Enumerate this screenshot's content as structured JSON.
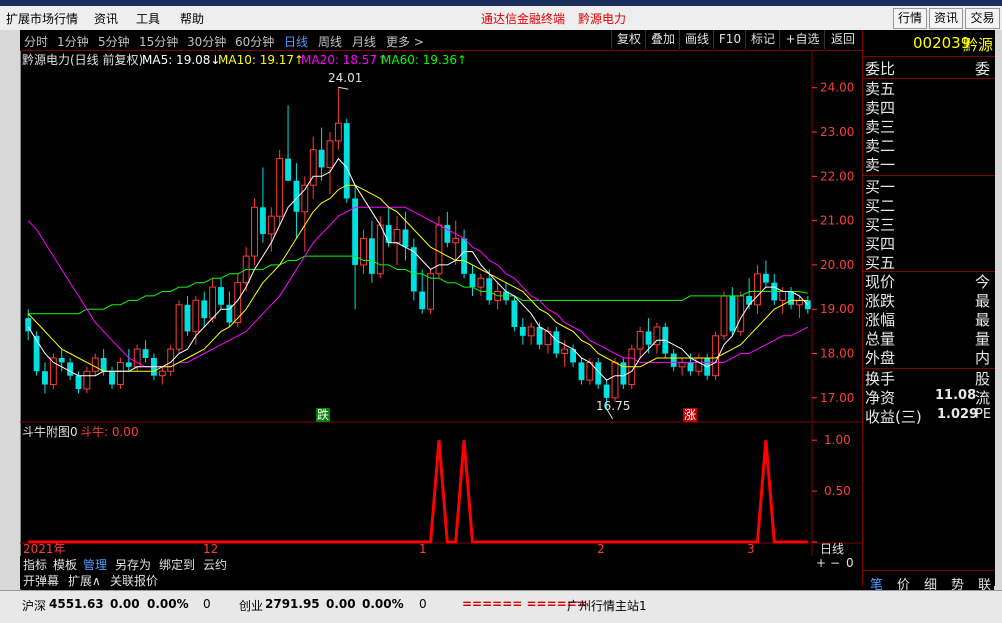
{
  "menubar": {
    "items": [
      "扩展市场行情",
      "资讯",
      "工具",
      "帮助"
    ],
    "center_red": [
      "通达信金融终端",
      "黔源电力"
    ],
    "right_buttons": [
      "行情",
      "资讯",
      "交易"
    ]
  },
  "periods": [
    "分时",
    "1分钟",
    "5分钟",
    "15分钟",
    "30分钟",
    "60分钟",
    "日线",
    "周线",
    "月线",
    "更多 >"
  ],
  "active_period": "日线",
  "tools": [
    "复权",
    "叠加",
    "画线",
    "F10",
    "标记",
    "+自选",
    "返回"
  ],
  "chart_header": {
    "title": "黔源电力(日线 前复权)",
    "ma5": "MA5: 19.08↓",
    "ma10": "MA10: 19.17↑",
    "ma20": "MA20: 18.57↑",
    "ma60": "MA60: 19.36↑"
  },
  "annotations": {
    "high": "24.01",
    "low": "16.75",
    "fall": "跌",
    "rise": "涨"
  },
  "indicator": {
    "name": "斗牛附图0",
    "label": "斗牛: 0.00"
  },
  "date_axis": [
    "2021年",
    "12",
    "1",
    "2",
    "3"
  ],
  "period_label": "日线",
  "zoom_controls": [
    "+",
    "−",
    "0"
  ],
  "chart_data": {
    "type": "candlestick",
    "ylim": [
      16.5,
      24.4
    ],
    "yticks": [
      17.0,
      18.0,
      19.0,
      20.0,
      21.0,
      22.0,
      23.0,
      24.0
    ],
    "ohlc": [
      [
        18.8,
        19.0,
        18.3,
        18.5
      ],
      [
        18.4,
        18.5,
        17.5,
        17.6
      ],
      [
        17.6,
        17.8,
        17.1,
        17.3
      ],
      [
        17.3,
        18.0,
        17.2,
        17.9
      ],
      [
        17.9,
        18.1,
        17.6,
        17.8
      ],
      [
        17.8,
        17.9,
        17.4,
        17.5
      ],
      [
        17.5,
        17.6,
        17.1,
        17.2
      ],
      [
        17.2,
        17.7,
        17.1,
        17.6
      ],
      [
        17.6,
        18.0,
        17.5,
        17.9
      ],
      [
        17.9,
        18.1,
        17.5,
        17.6
      ],
      [
        17.6,
        17.7,
        17.2,
        17.3
      ],
      [
        17.3,
        17.9,
        17.2,
        17.8
      ],
      [
        17.8,
        18.1,
        17.6,
        17.7
      ],
      [
        17.7,
        18.2,
        17.6,
        18.1
      ],
      [
        18.1,
        18.3,
        17.8,
        17.9
      ],
      [
        17.9,
        18.0,
        17.4,
        17.5
      ],
      [
        17.5,
        17.7,
        17.3,
        17.6
      ],
      [
        17.6,
        18.2,
        17.5,
        18.1
      ],
      [
        18.1,
        19.2,
        18.0,
        19.1
      ],
      [
        19.1,
        19.3,
        18.4,
        18.5
      ],
      [
        18.5,
        19.3,
        18.2,
        19.2
      ],
      [
        19.2,
        19.4,
        18.6,
        18.8
      ],
      [
        18.8,
        19.7,
        18.7,
        19.5
      ],
      [
        19.5,
        19.7,
        19.0,
        19.1
      ],
      [
        19.1,
        19.4,
        18.6,
        18.7
      ],
      [
        18.7,
        19.8,
        18.6,
        19.6
      ],
      [
        19.6,
        20.4,
        19.4,
        20.2
      ],
      [
        20.2,
        21.5,
        20.0,
        21.3
      ],
      [
        21.3,
        22.2,
        20.5,
        20.7
      ],
      [
        20.7,
        21.3,
        20.3,
        21.1
      ],
      [
        21.1,
        22.6,
        20.9,
        22.4
      ],
      [
        22.4,
        23.6,
        21.9,
        21.9
      ],
      [
        21.9,
        22.3,
        20.6,
        21.2
      ],
      [
        21.2,
        22.0,
        20.3,
        21.8
      ],
      [
        21.8,
        22.9,
        21.5,
        22.6
      ],
      [
        22.6,
        23.1,
        21.9,
        22.2
      ],
      [
        22.2,
        23.0,
        21.6,
        22.8
      ],
      [
        22.8,
        24.01,
        22.6,
        23.2
      ],
      [
        23.2,
        23.3,
        21.4,
        21.5
      ],
      [
        21.5,
        21.8,
        19.0,
        20.0
      ],
      [
        20.0,
        20.8,
        19.8,
        20.6
      ],
      [
        20.6,
        21.0,
        19.6,
        19.8
      ],
      [
        19.8,
        21.1,
        19.7,
        20.9
      ],
      [
        20.9,
        21.3,
        20.4,
        20.5
      ],
      [
        20.5,
        21.1,
        20.0,
        20.8
      ],
      [
        20.8,
        21.2,
        20.1,
        20.4
      ],
      [
        20.4,
        20.6,
        19.2,
        19.4
      ],
      [
        19.4,
        19.9,
        18.9,
        19.0
      ],
      [
        19.0,
        19.9,
        18.9,
        19.8
      ],
      [
        19.8,
        21.1,
        19.7,
        20.9
      ],
      [
        20.9,
        21.2,
        20.4,
        20.5
      ],
      [
        20.5,
        21.0,
        20.0,
        20.6
      ],
      [
        20.6,
        20.8,
        19.7,
        19.8
      ],
      [
        19.8,
        20.0,
        19.3,
        19.5
      ],
      [
        19.5,
        19.8,
        19.3,
        19.7
      ],
      [
        19.7,
        19.9,
        19.1,
        19.2
      ],
      [
        19.2,
        19.6,
        19.0,
        19.4
      ],
      [
        19.4,
        19.6,
        19.1,
        19.2
      ],
      [
        19.2,
        19.3,
        18.5,
        18.6
      ],
      [
        18.6,
        18.8,
        18.2,
        18.4
      ],
      [
        18.4,
        18.7,
        18.2,
        18.6
      ],
      [
        18.6,
        18.7,
        18.1,
        18.2
      ],
      [
        18.2,
        18.6,
        18.0,
        18.5
      ],
      [
        18.5,
        18.6,
        17.9,
        18.0
      ],
      [
        18.0,
        18.3,
        17.7,
        18.1
      ],
      [
        18.1,
        18.2,
        17.7,
        17.8
      ],
      [
        17.8,
        17.9,
        17.3,
        17.4
      ],
      [
        17.4,
        17.9,
        17.3,
        17.8
      ],
      [
        17.8,
        17.9,
        17.2,
        17.3
      ],
      [
        17.3,
        17.4,
        16.75,
        17.0
      ],
      [
        17.0,
        17.9,
        16.9,
        17.8
      ],
      [
        17.8,
        17.9,
        17.2,
        17.3
      ],
      [
        17.3,
        18.2,
        17.2,
        18.1
      ],
      [
        18.1,
        18.6,
        17.9,
        18.5
      ],
      [
        18.5,
        18.8,
        18.0,
        18.2
      ],
      [
        18.2,
        18.7,
        18.0,
        18.6
      ],
      [
        18.6,
        18.7,
        17.9,
        18.0
      ],
      [
        18.0,
        18.1,
        17.6,
        17.7
      ],
      [
        17.7,
        17.9,
        17.5,
        17.8
      ],
      [
        17.8,
        18.0,
        17.5,
        17.6
      ],
      [
        17.6,
        18.0,
        17.5,
        17.9
      ],
      [
        17.9,
        18.0,
        17.4,
        17.5
      ],
      [
        17.5,
        18.5,
        17.4,
        18.4
      ],
      [
        18.4,
        19.4,
        18.3,
        19.3
      ],
      [
        19.3,
        19.5,
        18.4,
        18.5
      ],
      [
        18.5,
        19.4,
        18.4,
        19.3
      ],
      [
        19.3,
        19.7,
        19.0,
        19.1
      ],
      [
        19.1,
        20.0,
        18.9,
        19.8
      ],
      [
        19.8,
        20.1,
        19.5,
        19.6
      ],
      [
        19.6,
        19.8,
        19.1,
        19.2
      ],
      [
        19.2,
        19.5,
        18.9,
        19.4
      ],
      [
        19.4,
        19.5,
        19.0,
        19.1
      ],
      [
        19.1,
        19.3,
        18.8,
        19.2
      ],
      [
        19.2,
        19.3,
        18.9,
        19.0
      ]
    ],
    "ma5": [
      18.6,
      18.3,
      18.0,
      17.8,
      17.7,
      17.6,
      17.5,
      17.5,
      17.5,
      17.6,
      17.6,
      17.6,
      17.6,
      17.7,
      17.7,
      17.7,
      17.7,
      17.8,
      18.0,
      18.1,
      18.4,
      18.6,
      18.8,
      19.0,
      19.0,
      19.2,
      19.5,
      19.9,
      20.2,
      20.5,
      20.9,
      21.3,
      21.5,
      21.7,
      22.0,
      22.0,
      22.1,
      22.4,
      22.2,
      21.8,
      21.5,
      21.2,
      20.9,
      20.5,
      20.5,
      20.4,
      20.3,
      20.1,
      19.9,
      20.0,
      20.0,
      20.1,
      20.3,
      20.3,
      20.0,
      19.8,
      19.6,
      19.4,
      19.3,
      19.1,
      18.9,
      18.6,
      18.5,
      18.3,
      18.2,
      18.1,
      17.9,
      17.8,
      17.6,
      17.4,
      17.5,
      17.5,
      17.6,
      17.9,
      18.1,
      18.3,
      18.3,
      18.2,
      18.1,
      17.9,
      17.8,
      17.7,
      17.8,
      18.2,
      18.4,
      18.8,
      19.1,
      19.3,
      19.5,
      19.5,
      19.4,
      19.4,
      19.3,
      19.1
    ],
    "ma10": [
      18.9,
      18.7,
      18.5,
      18.3,
      18.1,
      18.0,
      17.9,
      17.8,
      17.7,
      17.6,
      17.6,
      17.6,
      17.6,
      17.6,
      17.6,
      17.6,
      17.7,
      17.7,
      17.8,
      17.9,
      18.0,
      18.1,
      18.3,
      18.5,
      18.6,
      18.8,
      19.0,
      19.3,
      19.6,
      19.8,
      20.0,
      20.3,
      20.6,
      20.9,
      21.2,
      21.4,
      21.5,
      21.7,
      21.8,
      21.8,
      21.7,
      21.6,
      21.5,
      21.3,
      21.2,
      21.0,
      20.8,
      20.6,
      20.4,
      20.3,
      20.2,
      20.1,
      20.1,
      20.0,
      19.9,
      19.8,
      19.7,
      19.6,
      19.5,
      19.4,
      19.2,
      19.0,
      18.9,
      18.7,
      18.6,
      18.5,
      18.3,
      18.2,
      18.0,
      17.9,
      17.8,
      17.7,
      17.7,
      17.7,
      17.8,
      17.9,
      17.9,
      17.9,
      17.9,
      17.9,
      17.9,
      17.9,
      17.9,
      18.0,
      18.1,
      18.2,
      18.4,
      18.6,
      18.8,
      19.0,
      19.1,
      19.2,
      19.2,
      19.2
    ],
    "ma20": [
      21.0,
      20.8,
      20.5,
      20.2,
      19.9,
      19.6,
      19.3,
      19.0,
      18.7,
      18.5,
      18.3,
      18.1,
      17.9,
      17.8,
      17.7,
      17.7,
      17.7,
      17.7,
      17.8,
      17.8,
      17.9,
      18.0,
      18.1,
      18.2,
      18.3,
      18.4,
      18.5,
      18.7,
      18.9,
      19.1,
      19.3,
      19.6,
      19.9,
      20.2,
      20.5,
      20.7,
      20.9,
      21.1,
      21.2,
      21.3,
      21.3,
      21.3,
      21.3,
      21.3,
      21.3,
      21.3,
      21.2,
      21.1,
      21.0,
      20.9,
      20.8,
      20.7,
      20.6,
      20.4,
      20.3,
      20.1,
      20.0,
      19.8,
      19.7,
      19.5,
      19.3,
      19.2,
      19.0,
      18.9,
      18.7,
      18.6,
      18.5,
      18.3,
      18.2,
      18.1,
      18.0,
      17.9,
      17.9,
      17.8,
      17.8,
      17.8,
      17.8,
      17.8,
      17.8,
      17.8,
      17.8,
      17.8,
      17.8,
      17.8,
      17.9,
      18.0,
      18.0,
      18.1,
      18.2,
      18.3,
      18.4,
      18.4,
      18.5,
      18.6
    ],
    "ma60": [
      18.9,
      18.9,
      18.9,
      18.9,
      18.9,
      18.9,
      18.9,
      19.0,
      19.0,
      19.0,
      19.1,
      19.1,
      19.2,
      19.2,
      19.3,
      19.3,
      19.4,
      19.4,
      19.5,
      19.5,
      19.6,
      19.6,
      19.7,
      19.7,
      19.8,
      19.8,
      19.9,
      19.9,
      19.9,
      20.0,
      20.0,
      20.1,
      20.1,
      20.2,
      20.2,
      20.2,
      20.2,
      20.2,
      20.2,
      20.2,
      20.1,
      20.1,
      20.0,
      20.0,
      19.9,
      19.9,
      19.8,
      19.8,
      19.7,
      19.7,
      19.6,
      19.6,
      19.5,
      19.5,
      19.4,
      19.4,
      19.3,
      19.3,
      19.3,
      19.2,
      19.2,
      19.2,
      19.2,
      19.2,
      19.2,
      19.2,
      19.2,
      19.2,
      19.2,
      19.2,
      19.2,
      19.2,
      19.2,
      19.2,
      19.2,
      19.2,
      19.2,
      19.2,
      19.2,
      19.3,
      19.3,
      19.3,
      19.3,
      19.3,
      19.3,
      19.3,
      19.4,
      19.4,
      19.4,
      19.4,
      19.4,
      19.4,
      19.4,
      19.36
    ],
    "indicator_ylim": [
      0,
      1.1
    ],
    "indicator_yticks": [
      1.0,
      0.5,
      0.0
    ],
    "indicator_values": [
      0,
      0,
      0,
      0,
      0,
      0,
      0,
      0,
      0,
      0,
      0,
      0,
      0,
      0,
      0,
      0,
      0,
      0,
      0,
      0,
      0,
      0,
      0,
      0,
      0,
      0,
      0,
      0,
      0,
      0,
      0,
      0,
      0,
      0,
      0,
      0,
      0,
      0,
      0,
      0,
      0,
      0,
      0,
      0,
      0,
      0,
      0,
      0,
      0,
      1,
      0,
      0,
      1,
      0,
      0,
      0,
      0,
      0,
      0,
      0,
      0,
      0,
      0,
      0,
      0,
      0,
      0,
      0,
      0,
      0,
      0,
      0,
      0,
      0,
      0,
      0,
      0,
      0,
      0,
      0,
      0,
      0,
      0,
      0,
      0,
      0,
      0,
      0,
      1,
      0,
      0,
      0,
      0,
      0,
      0,
      0,
      0,
      0,
      0,
      0
    ],
    "colors": {
      "up": "#ff3c3c",
      "down": "#00e0e0",
      "ma5": "#ffffff",
      "ma10": "#ffff00",
      "ma20": "#ff00ff",
      "ma60": "#00ff00",
      "axis": "#ff3c3c"
    }
  },
  "right_panel": {
    "code": "002039",
    "name": "黔源",
    "weibi": "委比",
    "weicha": "委",
    "sells": [
      "卖五",
      "卖四",
      "卖三",
      "卖二",
      "卖一"
    ],
    "buys": [
      "买一",
      "买二",
      "买三",
      "买四",
      "买五"
    ],
    "stats_left": [
      "现价",
      "涨跌",
      "涨幅",
      "总量",
      "外盘"
    ],
    "stats_right": [
      "今",
      "最",
      "最",
      "量",
      "内"
    ],
    "huanshou": "换手",
    "gu": "股",
    "jingzi": "净资",
    "jingzi_val": "11.08",
    "liu": "流",
    "shouyi": "收益(三)",
    "shouyi_val": "1.029",
    "pe": "PE",
    "tabs": [
      "笔",
      "价",
      "细",
      "势",
      "联"
    ]
  },
  "bottom_tabs1": [
    "指标",
    "模板",
    "管理",
    "另存为",
    "绑定到",
    "云约"
  ],
  "bottom_tabs2": [
    "开弹幕",
    "扩展∧",
    "关联报价"
  ],
  "statusbar": {
    "sh_name": "沪深",
    "sh_val": "4551.63",
    "sh_chg": "0.00",
    "sh_pct": "0.00%",
    "sh_vol": "0",
    "cy_name": "创业",
    "cy_val": "2791.95",
    "cy_chg": "0.00",
    "cy_pct": "0.00%",
    "cy_vol": "0",
    "sep": "====== ======",
    "server": "广州行情主站1"
  }
}
